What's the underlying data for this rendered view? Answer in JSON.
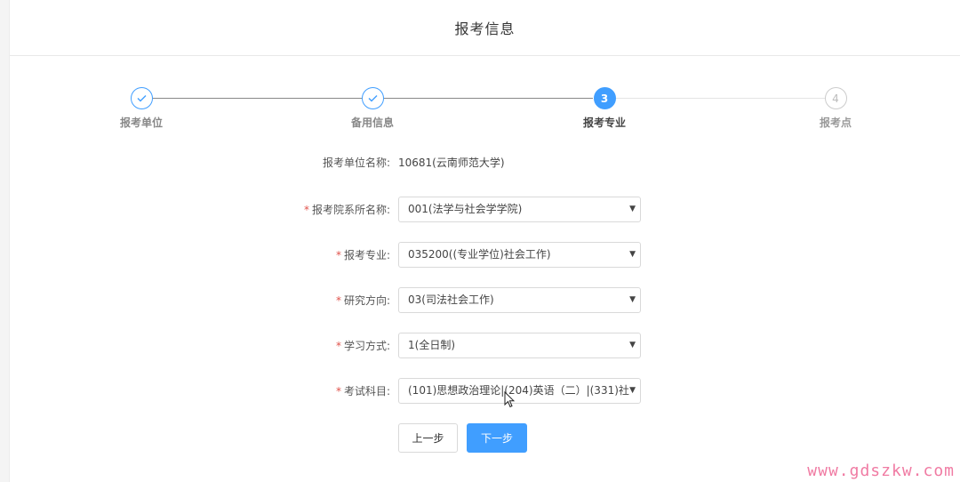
{
  "header": {
    "title": "报考信息"
  },
  "steps": [
    {
      "label": "报考单位",
      "state": "done"
    },
    {
      "label": "备用信息",
      "state": "done"
    },
    {
      "label": "报考专业",
      "state": "active",
      "number": "3"
    },
    {
      "label": "报考点",
      "state": "pending",
      "number": "4"
    }
  ],
  "form": {
    "unit": {
      "label": "报考单位名称:",
      "value": "10681(云南师范大学)"
    },
    "department": {
      "label": "报考院系所名称:",
      "value": "001(法学与社会学学院)"
    },
    "major": {
      "label": "报考专业:",
      "value": "035200((专业学位)社会工作)"
    },
    "direction": {
      "label": "研究方向:",
      "value": "03(司法社会工作)"
    },
    "study_mode": {
      "label": "学习方式:",
      "value": "1(全日制)"
    },
    "exam_subjects": {
      "label": "考试科目:",
      "value": "(101)思想政治理论|(204)英语（二）|(331)社"
    }
  },
  "buttons": {
    "prev": "上一步",
    "next": "下一步"
  },
  "watermark": "www.gdszkw.com",
  "colors": {
    "accent": "#409eff",
    "required": "#e0524b",
    "watermark": "#f07ba3"
  }
}
